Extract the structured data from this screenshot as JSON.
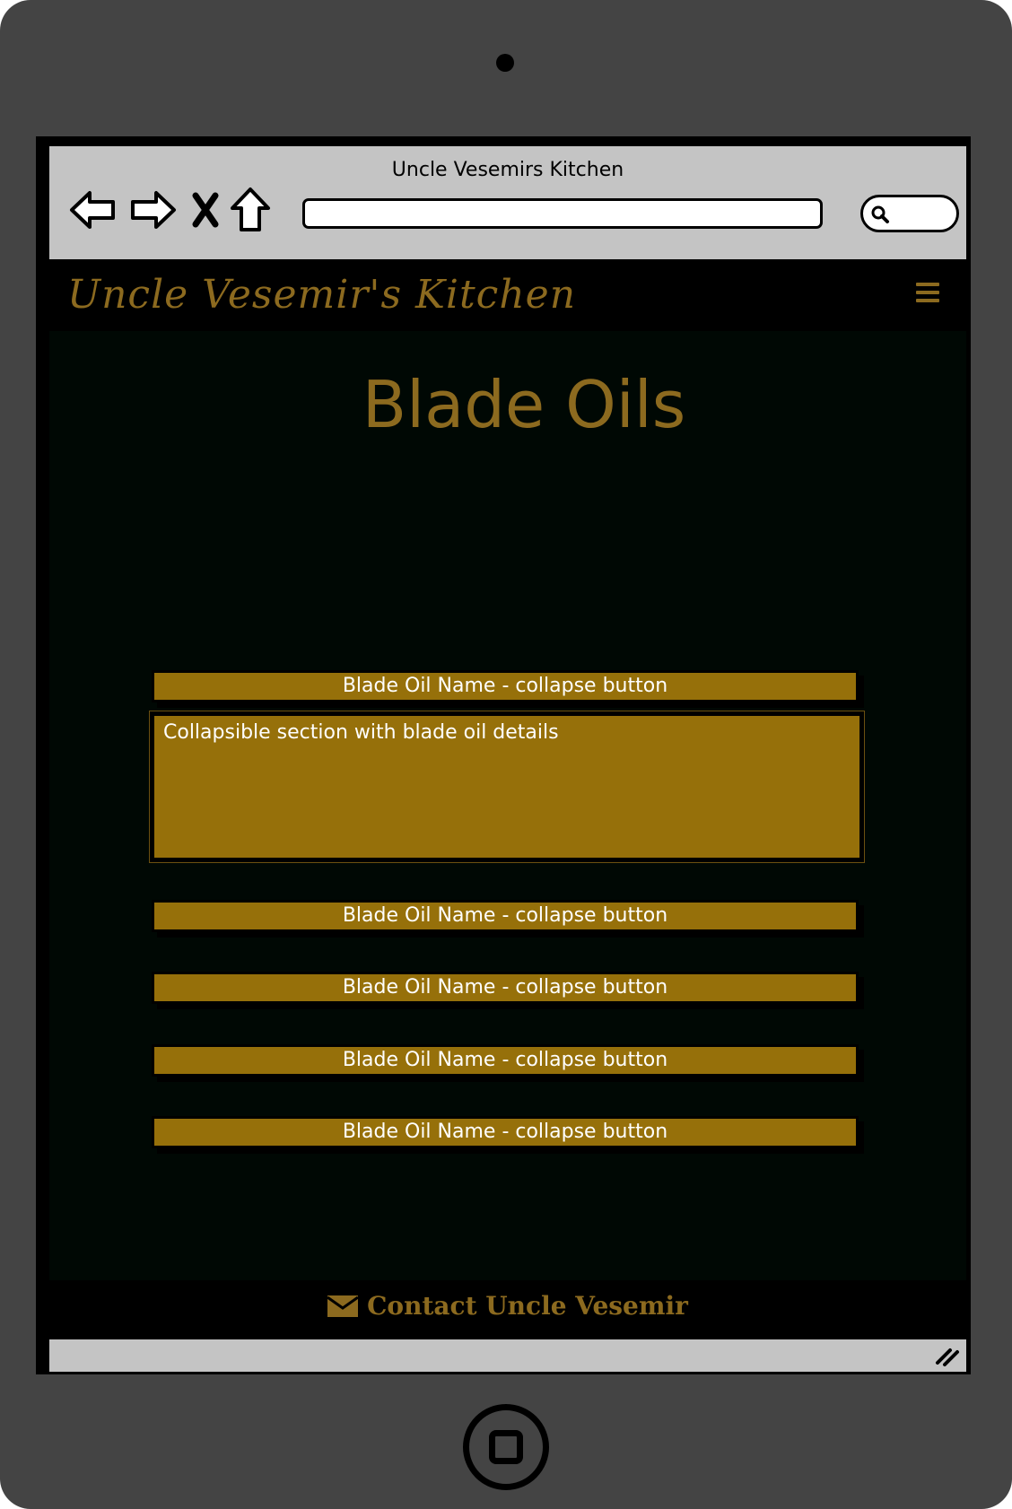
{
  "browser": {
    "window_title": "Uncle Vesemirs Kitchen",
    "url": "",
    "search_placeholder": ""
  },
  "site": {
    "brand": "Uncle Vesemir's Kitchen",
    "menu_icon": "hamburger-menu-icon"
  },
  "page": {
    "title": "Blade Oils",
    "accordion": [
      {
        "button_label": "Blade Oil Name - collapse button",
        "expanded": true,
        "details": "Collapsible section with blade oil details"
      },
      {
        "button_label": "Blade Oil Name - collapse button",
        "expanded": false
      },
      {
        "button_label": "Blade Oil Name - collapse button",
        "expanded": false
      },
      {
        "button_label": "Blade Oil Name - collapse button",
        "expanded": false
      },
      {
        "button_label": "Blade Oil Name - collapse button",
        "expanded": false
      }
    ]
  },
  "footer": {
    "contact_label": "Contact Uncle Vesemir",
    "contact_icon": "envelope-icon"
  },
  "colors": {
    "accent_gold": "#96700a",
    "brand_gold": "#8c6a1f",
    "page_background": "#000804",
    "device_frame": "#444444",
    "browser_chrome": "#c4c4c4"
  }
}
